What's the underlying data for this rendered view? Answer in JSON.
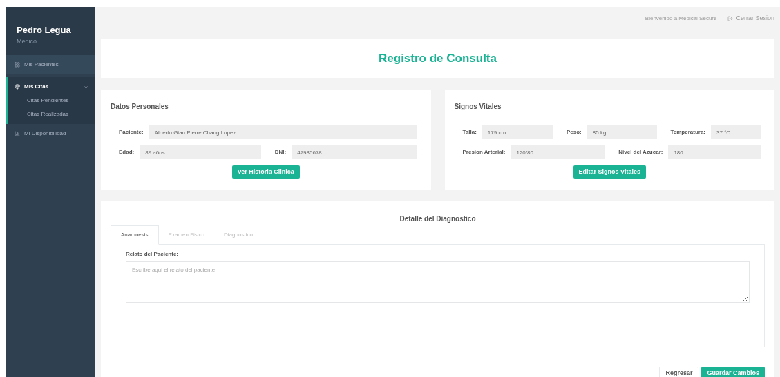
{
  "sidebar": {
    "user_name": "Pedro Legua",
    "role": "Medico",
    "items": [
      {
        "label": "Mis Pacientes",
        "selected": false
      },
      {
        "label": "Mis Citas",
        "selected": true,
        "expanded": true,
        "children": [
          {
            "label": "Citas Pendientes"
          },
          {
            "label": "Citas Realizadas"
          }
        ]
      },
      {
        "label": "Mi Disponibilidad",
        "selected": false
      }
    ]
  },
  "topbar": {
    "welcome": "Bienvenido a Medical Secure",
    "logout": "Cerrar Sesion"
  },
  "page_title": "Registro de Consulta",
  "cards": [
    {
      "title": "Datos Personales",
      "rows": [
        [
          {
            "label": "Paciente:",
            "value": "Alberto Gian Pierre Chang Lopez"
          }
        ],
        [
          {
            "label": "Edad:",
            "value": "89 años"
          },
          {
            "label": "DNI:",
            "value": "47985678"
          }
        ]
      ],
      "button": "Ver Historia Clinica"
    },
    {
      "title": "Signos Vitales",
      "rows": [
        [
          {
            "label": "Talla:",
            "value": "179 cm"
          },
          {
            "label": "Peso:",
            "value": "85 kg"
          },
          {
            "label": "Temperatura:",
            "value": "37 °C"
          }
        ],
        [
          {
            "label": "Presion Arterial:",
            "value": "120/80"
          },
          {
            "label": "Nivel del Azucar:",
            "value": "180"
          }
        ]
      ],
      "button": "Editar Signos Vitales"
    }
  ],
  "diagnosis": {
    "title": "Detalle del Diagnostico",
    "tabs": [
      {
        "label": "Anamnesis",
        "selected": true
      },
      {
        "label": "Examen Fisico",
        "selected": false
      },
      {
        "label": "Diagnostico",
        "selected": false
      }
    ],
    "field_label": "Relato del Paciente:",
    "placeholder": "Escribe aqui el relato del paciente"
  },
  "buttons": [
    {
      "label": "Regresar",
      "kind": "secondary"
    },
    {
      "label": "Guardar Cambios",
      "kind": "primary"
    }
  ]
}
